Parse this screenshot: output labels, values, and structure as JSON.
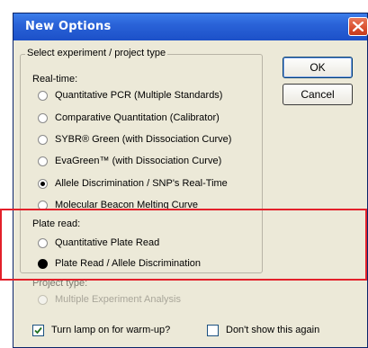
{
  "dialog": {
    "title": "New Options"
  },
  "group": {
    "legend": "Select experiment / project type"
  },
  "realtime": {
    "label": "Real-time:",
    "options": [
      {
        "label": "Quantitative PCR (Multiple Standards)",
        "selected": false
      },
      {
        "label": "Comparative Quantitation (Calibrator)",
        "selected": false
      },
      {
        "label": "SYBR® Green (with Dissociation Curve)",
        "selected": false
      },
      {
        "label": "EvaGreen™ (with Dissociation Curve)",
        "selected": false
      },
      {
        "label": "Allele Discrimination / SNP's Real-Time",
        "selected": true
      },
      {
        "label": "Molecular Beacon Melting Curve",
        "selected": false
      }
    ]
  },
  "plate_read": {
    "label": "Plate read:",
    "options": [
      {
        "label": "Quantitative Plate Read",
        "selected": false
      },
      {
        "label": "Plate Read / Allele Discrimination",
        "selected": true
      }
    ]
  },
  "project": {
    "label": "Project type:",
    "options": [
      {
        "label": "Multiple Experiment Analysis",
        "selected": false,
        "disabled": true
      }
    ]
  },
  "buttons": {
    "ok": "OK",
    "cancel": "Cancel"
  },
  "checkboxes": {
    "lamp": {
      "label": "Turn lamp on for warm-up?",
      "checked": true
    },
    "dont_show": {
      "label": "Don't show this again",
      "checked": false
    }
  },
  "colors": {
    "titlebar": "#2a63d8",
    "highlight": "#e3202a",
    "dialog_bg": "#ece9d8"
  }
}
